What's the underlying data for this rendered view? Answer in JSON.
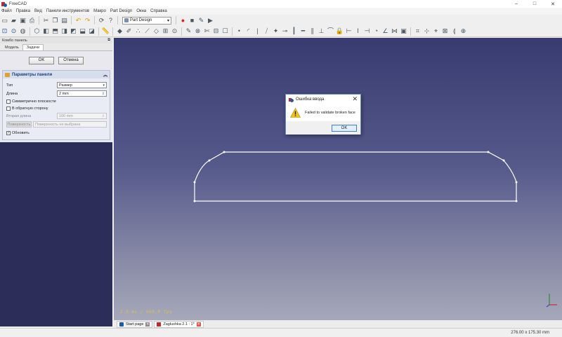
{
  "window": {
    "title": "FreeCAD",
    "controls": [
      "–",
      "□",
      "✕"
    ]
  },
  "menu": [
    "Файл",
    "Правка",
    "Вид",
    "Панели инструментов",
    "Макро",
    "Part Design",
    "Окна",
    "Справка"
  ],
  "toolbar": {
    "workbench": "Part Design"
  },
  "combo": {
    "title": "Комбо панель",
    "tabs": [
      "Модель",
      "Задачи"
    ],
    "ok_label": "OK",
    "cancel_label": "Отмена",
    "panel_title": "Параметры панели",
    "type_label": "Тип",
    "type_value": "Размер",
    "length_label": "Длина",
    "length_value": "2 mm",
    "symmetric_label": "Симметрично плоскости",
    "reversed_label": "В обратную сторону",
    "second_length_label": "Вторая длина",
    "second_length_value": "100 mm",
    "face_button": "Поверхность",
    "face_placeholder": "Поверхность не выбрана",
    "update_label": "Обновить"
  },
  "view": {
    "fps": "2.0 ms / 500.0 fps"
  },
  "doc_tabs": [
    {
      "label": "Start page"
    },
    {
      "label": "Zaglushka 2.1 : 1*"
    }
  ],
  "status": {
    "dimensions": "276.00 x 175.30 mm"
  },
  "dialog": {
    "title": "Ошибка ввода",
    "message": "Failed to validate broken face",
    "ok_label": "OK"
  },
  "colors": {
    "view_top": "#373b70",
    "view_bottom": "#a6a8ba",
    "panel_bg": "#2c2d58",
    "accent": "#3c7fd6",
    "record": "#e02020"
  }
}
